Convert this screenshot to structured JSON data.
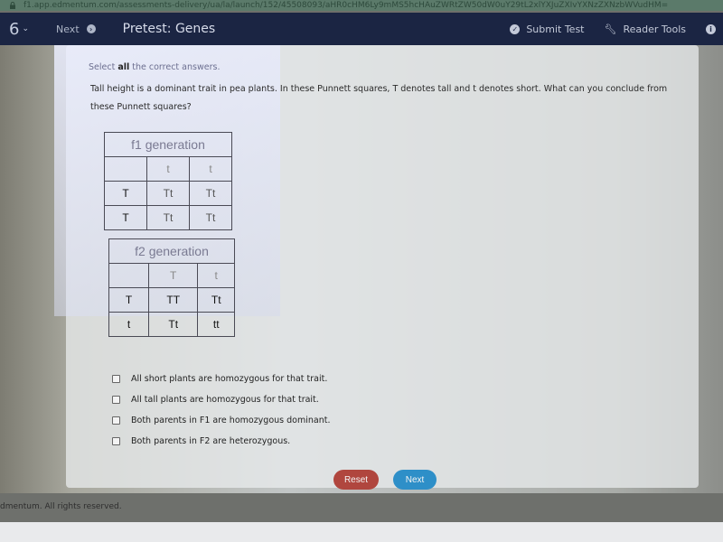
{
  "browser": {
    "url": "f1.app.edmentum.com/assessments-delivery/ua/la/launch/152/45508093/aHR0cHM6Ly9mMS5hcHAuZWRtZW50dW0uY29tL2xlYXJuZXIvYXNzZXNzbWVudHM="
  },
  "nav": {
    "question_number": "6",
    "next_label": "Next",
    "title": "Pretest: Genes",
    "submit_label": "Submit Test",
    "reader_tools_label": "Reader Tools"
  },
  "question": {
    "instruction_pre": "Select ",
    "instruction_bold": "all",
    "instruction_post": " the correct answers.",
    "text": "Tall height is a dominant trait in pea plants. In these Punnett squares, T denotes tall and t denotes short. What can you conclude from these Punnett squares?"
  },
  "punnett_f1": {
    "title": "f1 generation",
    "col_alleles": [
      "t",
      "t"
    ],
    "rows": [
      {
        "allele": "T",
        "cells": [
          "Tt",
          "Tt"
        ]
      },
      {
        "allele": "T",
        "cells": [
          "Tt",
          "Tt"
        ]
      }
    ]
  },
  "punnett_f2": {
    "title": "f2 generation",
    "col_alleles": [
      "T",
      "t"
    ],
    "rows": [
      {
        "allele": "T",
        "cells": [
          "TT",
          "Tt"
        ]
      },
      {
        "allele": "t",
        "cells": [
          "Tt",
          "tt"
        ]
      }
    ]
  },
  "options": [
    {
      "label": "All short plants are homozygous for that trait.",
      "checked": false
    },
    {
      "label": "All tall plants are homozygous for that trait.",
      "checked": false
    },
    {
      "label": "Both parents in F1 are homozygous dominant.",
      "checked": false
    },
    {
      "label": "Both parents in F2 are heterozygous.",
      "checked": false
    }
  ],
  "buttons": {
    "reset": "Reset",
    "next": "Next"
  },
  "footer": {
    "text": "dmentum. All rights reserved."
  },
  "colors": {
    "navbar": "#1b2543",
    "reset": "#b0463e",
    "next": "#2e8fc8"
  }
}
